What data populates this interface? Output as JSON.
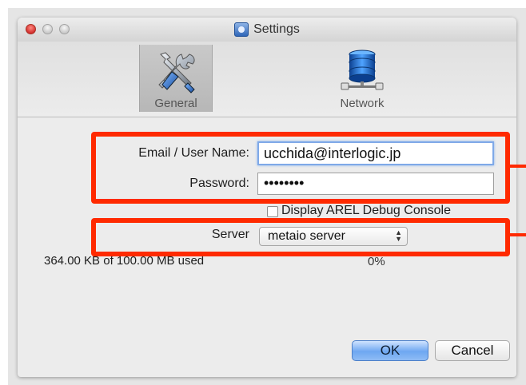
{
  "window": {
    "title": "Settings"
  },
  "toolbar": {
    "items": [
      {
        "label": "General",
        "icon": "tools-icon",
        "selected": true
      },
      {
        "label": "Network",
        "icon": "database-network-icon",
        "selected": false
      }
    ]
  },
  "account": {
    "email_label": "Email / User Name:",
    "email_value": "ucchida@interlogic.jp",
    "password_label": "Password:",
    "password_value": "••••••••"
  },
  "debug": {
    "checkbox_label": "Display AREL Debug Console",
    "checked": false
  },
  "server": {
    "label": "Server",
    "selected": "metaio server"
  },
  "storage": {
    "usage_text": "364.00 KB of 100.00 MB used",
    "percent_text": "0%"
  },
  "buttons": {
    "ok": "OK",
    "cancel": "Cancel"
  },
  "colors": {
    "highlight": "#ff2a00",
    "focus_ring": "#7fa9e8",
    "primary_button": "#6ea7f1"
  }
}
